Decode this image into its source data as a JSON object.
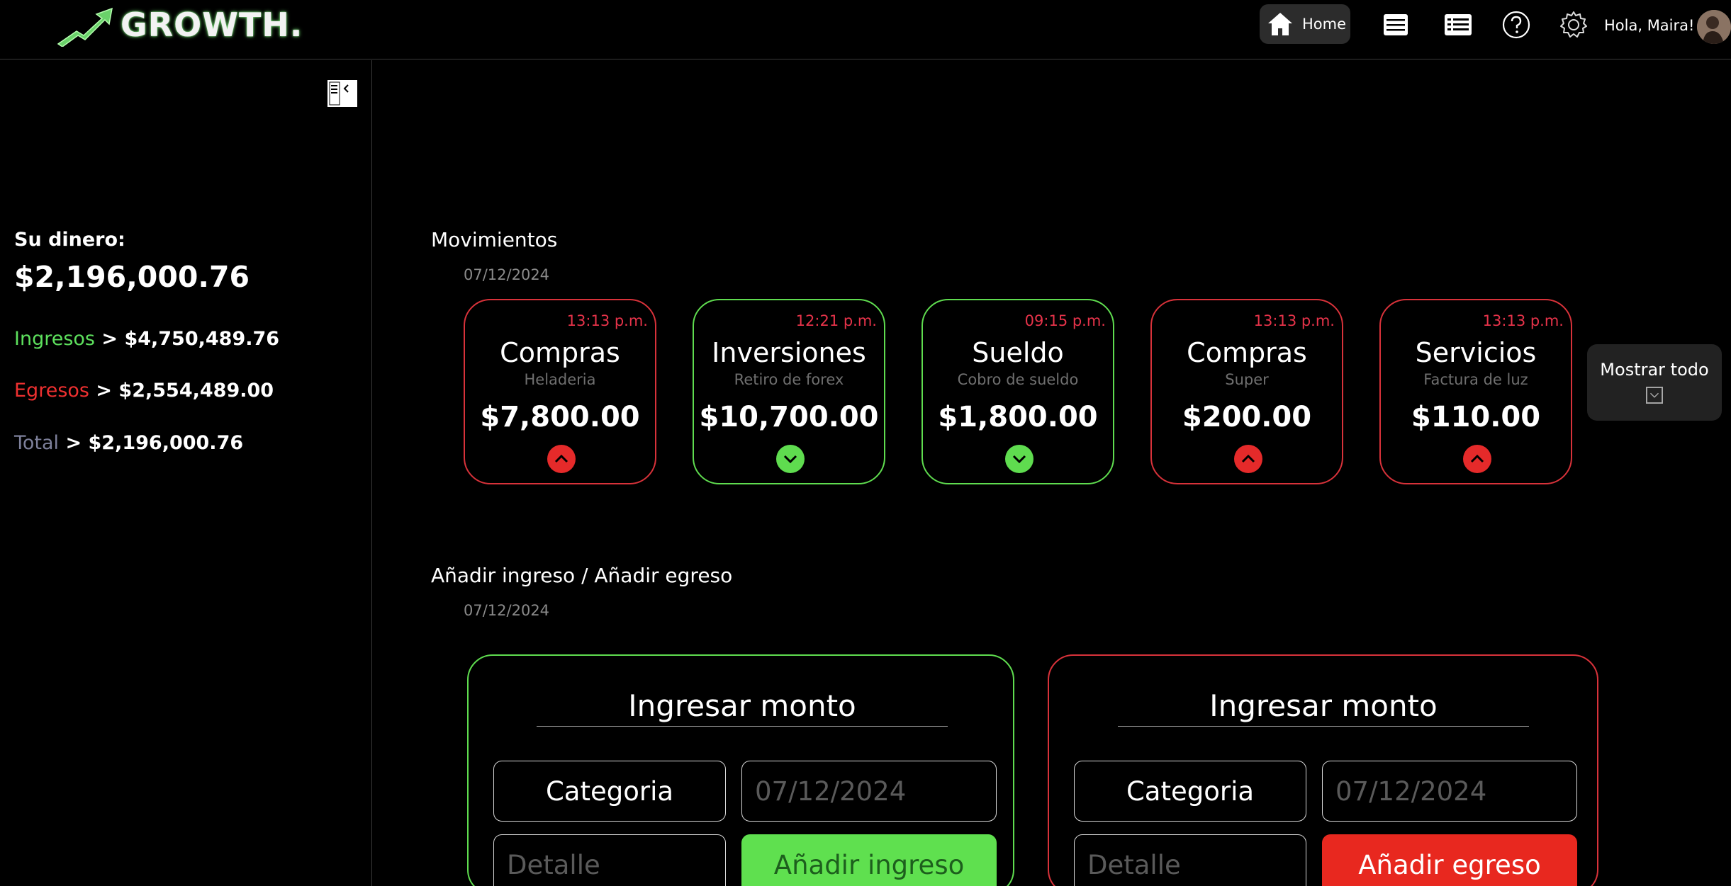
{
  "brand": {
    "name": "GROWTH."
  },
  "header": {
    "home_label": "Home",
    "greeting": "Hola, Maira!",
    "icons": [
      "home-icon",
      "list-icon",
      "ledger-icon",
      "help-icon",
      "settings-icon"
    ]
  },
  "sidebar": {
    "money_label": "Su dinero:",
    "money_value": "$2,196,000.76",
    "stats": [
      {
        "label": "Ingresos",
        "sep": " > ",
        "value": "$4,750,489.76"
      },
      {
        "label": "Egresos",
        "sep": " > ",
        "value": "$2,554,489.00"
      },
      {
        "label": "Total",
        "sep": " > ",
        "value": "$2,196,000.76"
      }
    ]
  },
  "movements": {
    "title": "Movimientos",
    "date": "07/12/2024",
    "show_all_label": "Mostrar todo",
    "cards": [
      {
        "time": "13:13 p.m.",
        "category": "Compras",
        "detail": "Heladeria",
        "amount": "$7,800.00",
        "type": "expense"
      },
      {
        "time": "12:21 p.m.",
        "category": "Inversiones",
        "detail": "Retiro de forex",
        "amount": "$10,700.00",
        "type": "income"
      },
      {
        "time": "09:15 p.m.",
        "category": "Sueldo",
        "detail": "Cobro de sueldo",
        "amount": "$1,800.00",
        "type": "income"
      },
      {
        "time": "13:13 p.m.",
        "category": "Compras",
        "detail": "Super",
        "amount": "$200.00",
        "type": "expense"
      },
      {
        "time": "13:13 p.m.",
        "category": "Servicios",
        "detail": "Factura de luz",
        "amount": "$110.00",
        "type": "expense"
      }
    ]
  },
  "add": {
    "title": "Añadir ingreso / Añadir egreso",
    "date": "07/12/2024",
    "income_form": {
      "amount_placeholder": "Ingresar monto",
      "category_label": "Categoria",
      "date_placeholder": "07/12/2024",
      "detail_placeholder": "Detalle",
      "submit_label": "Añadir ingreso"
    },
    "expense_form": {
      "amount_placeholder": "Ingresar monto",
      "category_label": "Categoria",
      "date_placeholder": "07/12/2024",
      "detail_placeholder": "Detalle",
      "submit_label": "Añadir egreso"
    }
  },
  "colors": {
    "income": "#5fdc4f",
    "expense": "#d8323a",
    "total": "#7d809a",
    "time_text": "#e7334a",
    "background": "#000000"
  }
}
